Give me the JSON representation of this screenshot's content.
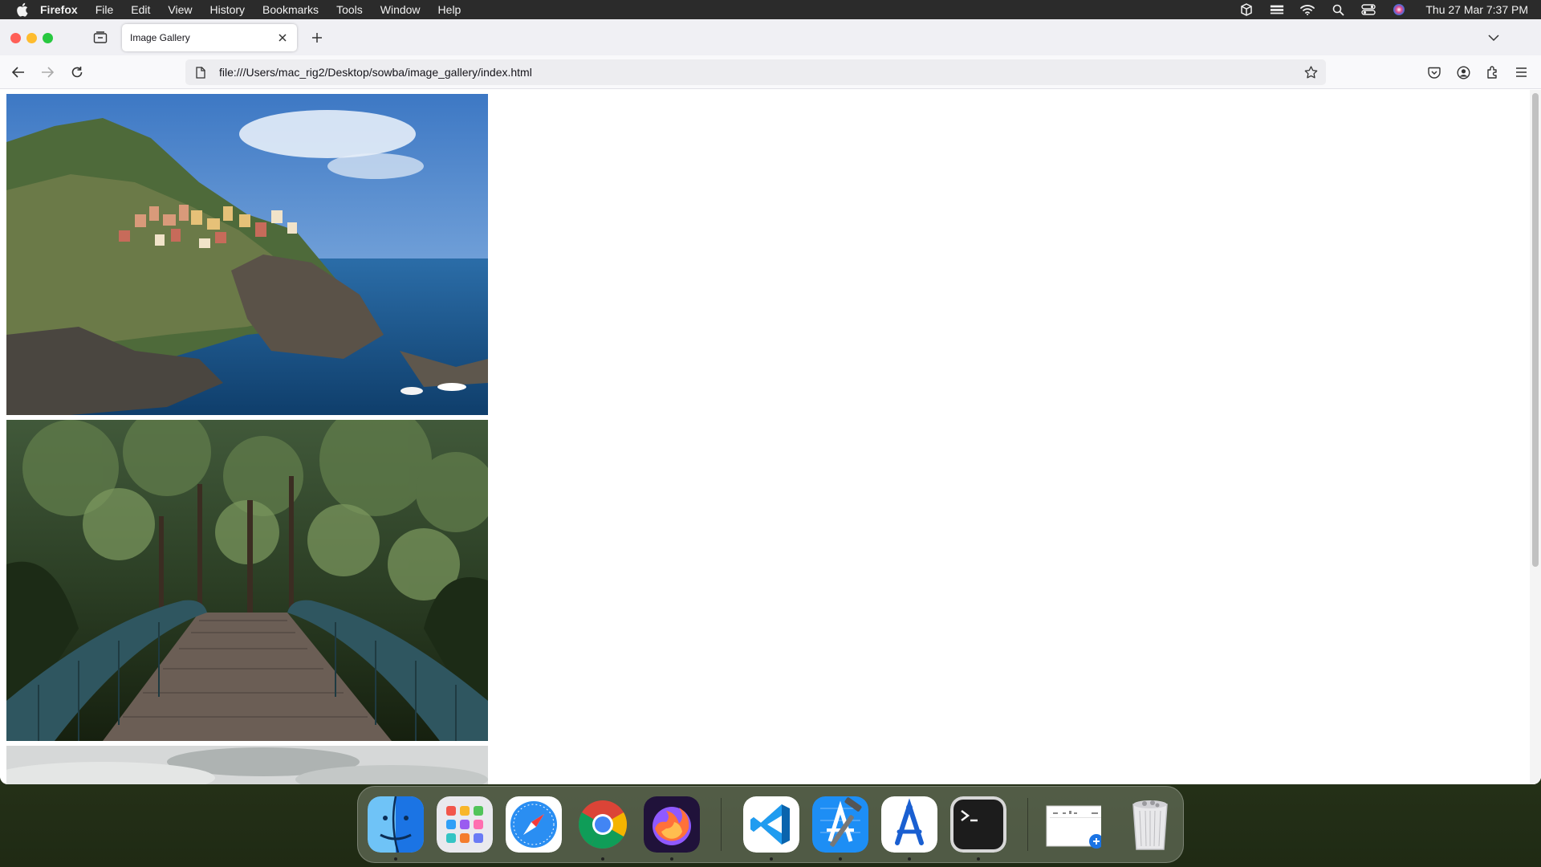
{
  "menubar": {
    "app_name": "Firefox",
    "items": [
      "File",
      "Edit",
      "View",
      "History",
      "Bookmarks",
      "Tools",
      "Window",
      "Help"
    ],
    "clock": "Thu 27 Mar  7:37 PM"
  },
  "browser": {
    "tab_title": "Image Gallery",
    "url": "file:///Users/mac_rig2/Desktop/sowba/image_gallery/index.html"
  },
  "gallery": {
    "images": [
      {
        "name": "coastal-village-photo"
      },
      {
        "name": "forest-bridge-photo"
      },
      {
        "name": "sky-landscape-photo"
      }
    ]
  },
  "dock": {
    "apps": [
      "Finder",
      "Launchpad",
      "Safari",
      "Google Chrome",
      "Firefox",
      "Visual Studio Code",
      "Xcode",
      "Instruments",
      "Terminal",
      "Preview",
      "Trash"
    ]
  },
  "colors": {
    "menubar_bg": "#2b2b2b",
    "tabstrip_bg": "#f0f0f4",
    "urlbar_bg": "#ededf0",
    "close": "#ff5f57",
    "minimize": "#febc2e",
    "maximize": "#28c840"
  }
}
